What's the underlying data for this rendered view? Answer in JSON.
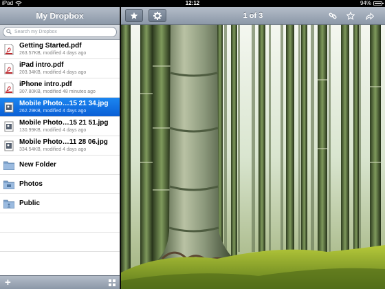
{
  "statusbar": {
    "carrier": "iPad",
    "time": "12:12",
    "battery": "94%"
  },
  "sidebar": {
    "title": "My Dropbox",
    "search_placeholder": "Search my Dropbox",
    "files": [
      {
        "name": "Getting Started.pdf",
        "meta": "263.57KB, modified 4 days ago",
        "icon": "pdf-icon"
      },
      {
        "name": "iPad intro.pdf",
        "meta": "203.34KB, modified 4 days ago",
        "icon": "pdf-icon"
      },
      {
        "name": "iPhone intro.pdf",
        "meta": "307.80KB, modified 48 minutes ago",
        "icon": "pdf-icon"
      },
      {
        "name": "Mobile Photo…15 21 34.jpg",
        "meta": "262.29KB, modified 4 days ago",
        "icon": "image-icon",
        "selected": true
      },
      {
        "name": "Mobile Photo…15 21 51.jpg",
        "meta": "130.99KB, modified 4 days ago",
        "icon": "image-icon"
      },
      {
        "name": "Mobile Photo…11 28 06.jpg",
        "meta": "334.54KB, modified 4 days ago",
        "icon": "image-icon"
      }
    ],
    "folders": [
      {
        "name": "New Folder",
        "icon": "folder-icon"
      },
      {
        "name": "Photos",
        "icon": "photos-folder-icon"
      },
      {
        "name": "Public",
        "icon": "public-folder-icon"
      }
    ]
  },
  "toolbar": {
    "pager": "1 of 3",
    "icons": [
      "favorite-star-button-icon",
      "settings-gear-icon",
      "link-icon",
      "star-icon",
      "share-icon"
    ]
  },
  "colors": {
    "selection": "#0a5fd5",
    "bar": "#8c98a8"
  }
}
